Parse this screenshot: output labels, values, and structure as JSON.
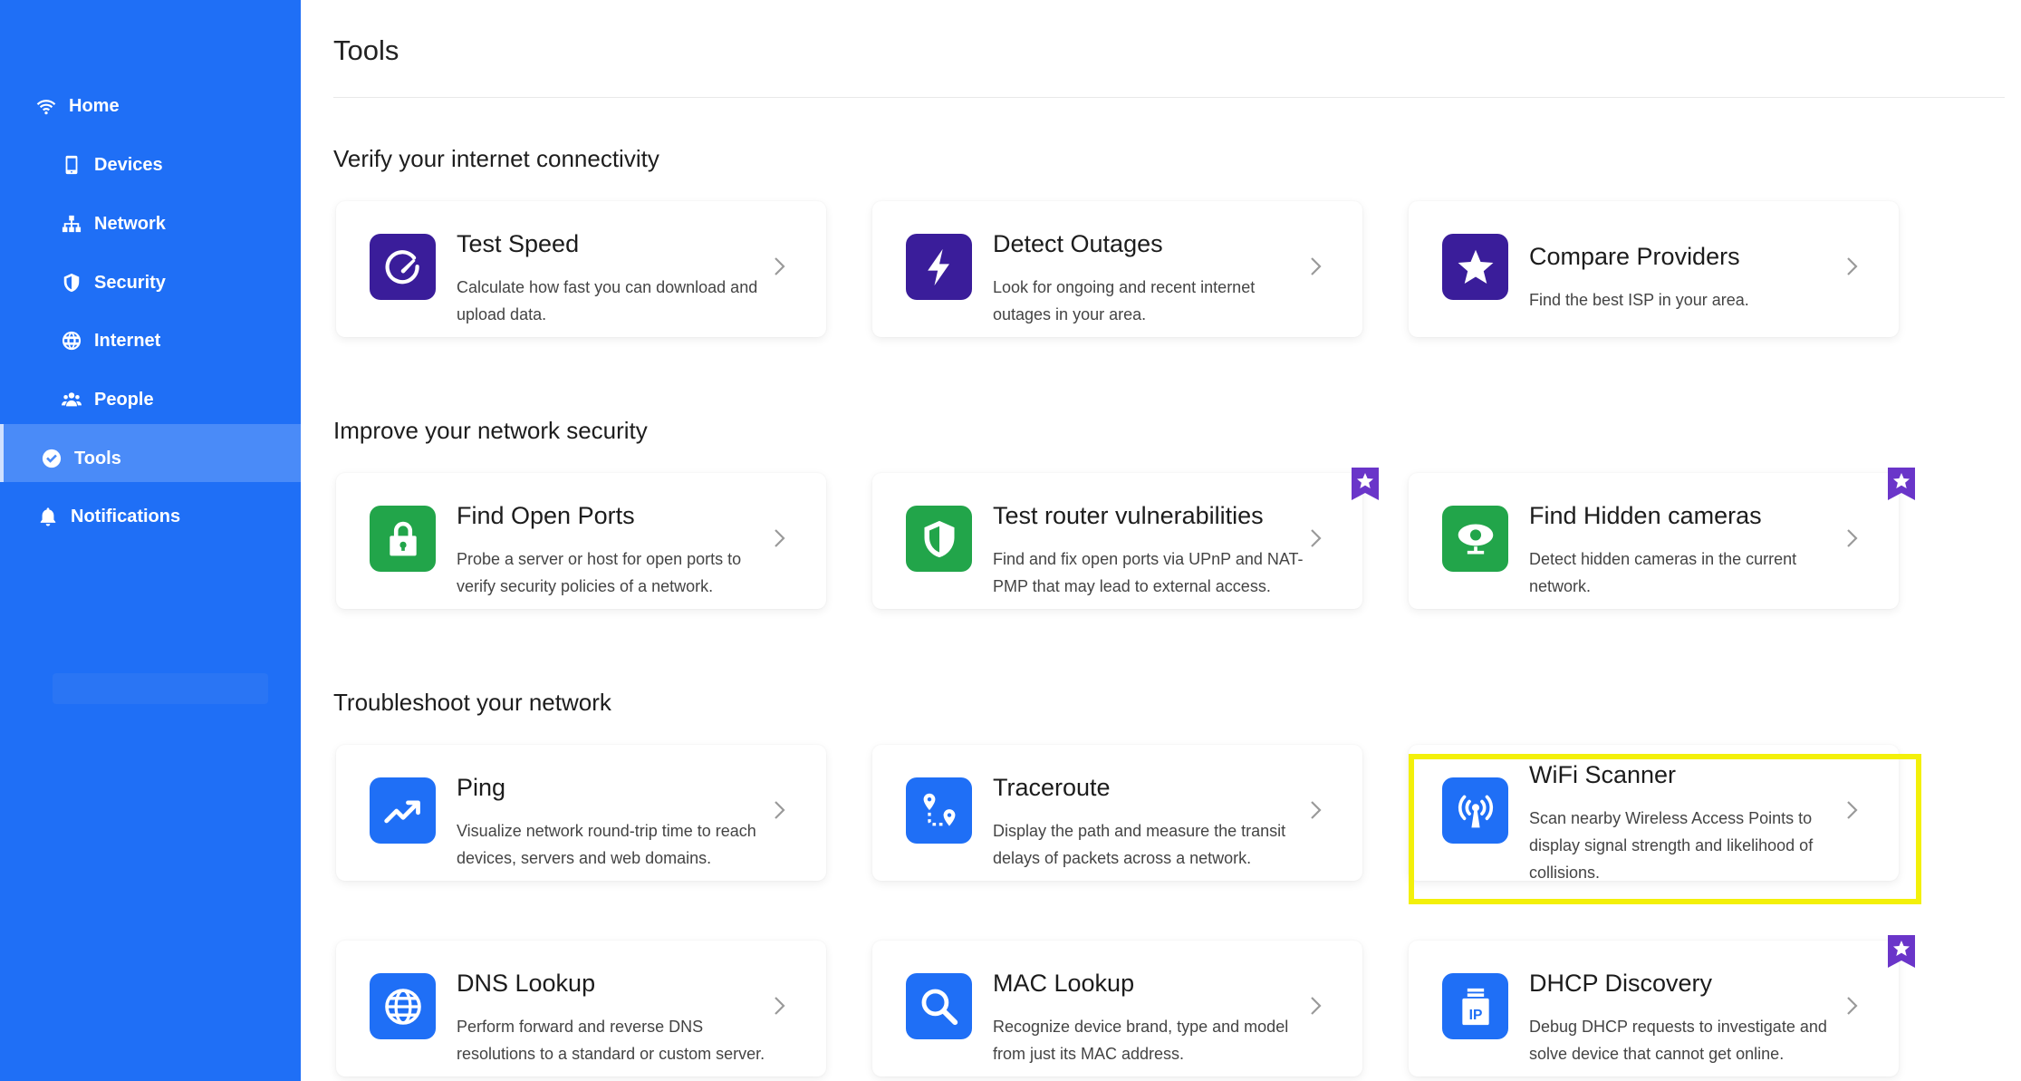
{
  "sidebar": {
    "items": [
      {
        "label": "Home",
        "icon": "wifi-icon"
      },
      {
        "label": "Devices",
        "icon": "phone-icon"
      },
      {
        "label": "Network",
        "icon": "network-icon"
      },
      {
        "label": "Security",
        "icon": "shield-icon"
      },
      {
        "label": "Internet",
        "icon": "globe-icon"
      },
      {
        "label": "People",
        "icon": "people-icon"
      },
      {
        "label": "Tools",
        "icon": "check-circle-icon",
        "active": true
      },
      {
        "label": "Notifications",
        "icon": "bell-icon"
      }
    ]
  },
  "page": {
    "title": "Tools"
  },
  "sections": [
    {
      "title": "Verify your internet connectivity",
      "cards": [
        {
          "title": "Test Speed",
          "desc": "Calculate how fast you can download and upload data.",
          "icon": "speedometer-icon",
          "color": "#3a1d9a",
          "badge": false
        },
        {
          "title": "Detect Outages",
          "desc": "Look for ongoing and recent internet outages in your area.",
          "icon": "lightning-icon",
          "color": "#3a1d9a",
          "badge": false
        },
        {
          "title": "Compare Providers",
          "desc": "Find the best ISP in your area.",
          "icon": "star-icon",
          "color": "#3a1d9a",
          "badge": false
        }
      ]
    },
    {
      "title": "Improve your network security",
      "cards": [
        {
          "title": "Find Open Ports",
          "desc": "Probe a server or host for open ports to verify security policies of a network.",
          "icon": "lock-icon",
          "color": "#22a54a",
          "badge": false
        },
        {
          "title": "Test router vulnerabilities",
          "desc": "Find and fix open ports via UPnP and NAT-PMP that may lead to external access.",
          "icon": "shield-icon",
          "color": "#22a54a",
          "badge": true
        },
        {
          "title": "Find Hidden cameras",
          "desc": "Detect hidden cameras in the current network.",
          "icon": "camera-icon",
          "color": "#22a54a",
          "badge": true
        }
      ]
    },
    {
      "title": "Troubleshoot your network",
      "cards": [
        {
          "title": "Ping",
          "desc": "Visualize network round-trip time to reach devices, servers and web domains.",
          "icon": "trend-icon",
          "color": "#1f6ff6",
          "badge": false
        },
        {
          "title": "Traceroute",
          "desc": "Display the path and measure the transit delays of packets across a network.",
          "icon": "route-icon",
          "color": "#1f6ff6",
          "badge": false
        },
        {
          "title": "WiFi Scanner",
          "desc": "Scan nearby Wireless Access Points to display signal strength and likelihood of collisions.",
          "icon": "antenna-icon",
          "color": "#1f6ff6",
          "badge": false,
          "highlighted": true
        }
      ]
    },
    {
      "title": "",
      "cards": [
        {
          "title": "DNS Lookup",
          "desc": "Perform forward and reverse DNS resolutions to a standard or custom server.",
          "icon": "globe-icon",
          "color": "#1f6ff6",
          "badge": false
        },
        {
          "title": "MAC Lookup",
          "desc": "Recognize device brand, type and model from just its MAC address.",
          "icon": "search-icon",
          "color": "#1f6ff6",
          "badge": false
        },
        {
          "title": "DHCP Discovery",
          "desc": "Debug DHCP requests to investigate and solve device that cannot get online.",
          "icon": "ip-icon",
          "color": "#1f6ff6",
          "badge": true
        }
      ]
    }
  ],
  "colors": {
    "sidebar": "#1f6ff6",
    "purple": "#3a1d9a",
    "green": "#22a54a",
    "blue": "#1f6ff6",
    "badge": "#6a35c9",
    "highlight": "#f3f00a"
  }
}
